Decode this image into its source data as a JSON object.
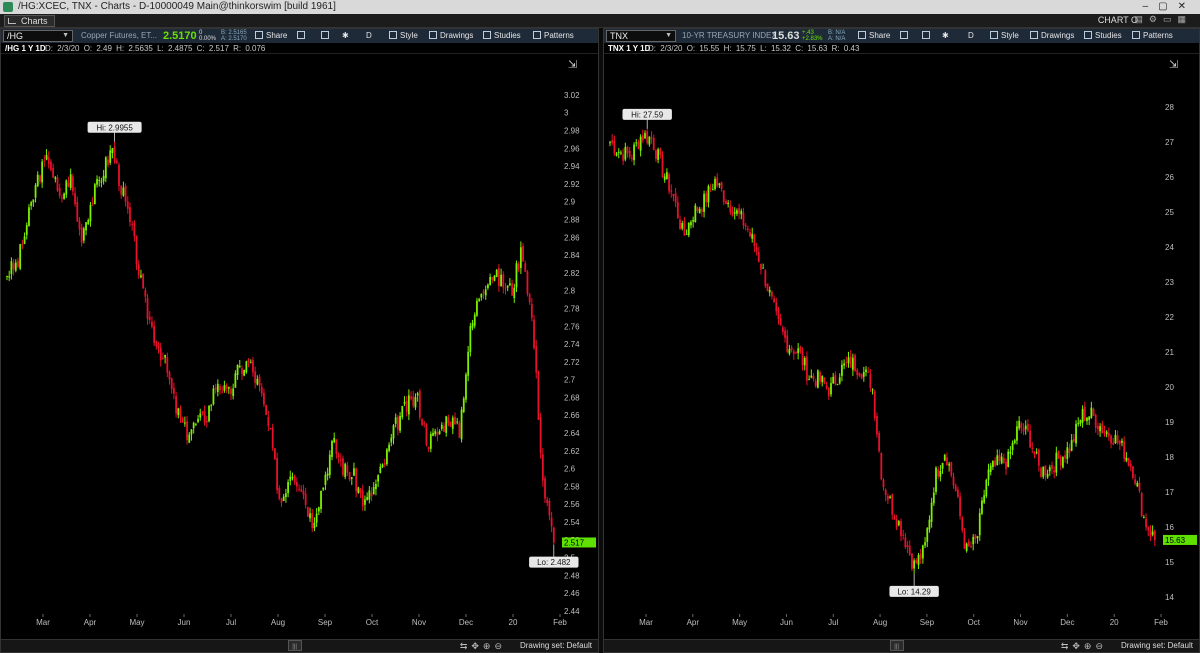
{
  "window": {
    "title": "/HG:XCEC, TNX - Charts - D-10000049 Main@thinkorswim [build 1961]"
  },
  "menubar": {
    "tab_label": "Charts",
    "chart_label": "CHART O"
  },
  "colors": {
    "up": "#7cf000",
    "down": "#e8102a",
    "toolbar": "#1e2a38",
    "price_tag": "#5fe000"
  },
  "panes": [
    {
      "symbol": "/HG",
      "description": "Copper Futures, ET...",
      "last": "2.5170",
      "change": "0",
      "change_pct": "0.00%",
      "bid": "B: 2.5165",
      "ask": "A: 2.5170",
      "toolbar": {
        "share": "Share",
        "period": "D",
        "style": "Style",
        "drawings": "Drawings",
        "studies": "Studies",
        "patterns": "Patterns"
      },
      "period_label": "/HG 1 Y 1D",
      "ohlc": "D: 2/3/20  O: 2.49  H: 2.5635  L: 2.4875  C: 2.517  R: 0.076",
      "hi_label": "Hi: 2.9955",
      "lo_label": "Lo: 2.482",
      "price_tag": "2.517",
      "drawing_set": "Drawing set: Default"
    },
    {
      "symbol": "TNX",
      "description": "10-YR TREASURY INDEX",
      "last": "15.63",
      "change": "+.43",
      "change_pct": "+2.83%",
      "bid": "B: N/A",
      "ask": "A: N/A",
      "toolbar": {
        "share": "Share",
        "period": "D",
        "style": "Style",
        "drawings": "Drawings",
        "studies": "Studies",
        "patterns": "Patterns"
      },
      "period_label": "TNX 1 Y 1D",
      "ohlc": "D: 2/3/20  O: 15.55  H: 15.75  L: 15.32  C: 15.63  R: 0.43",
      "hi_label": "Hi: 27.59",
      "lo_label": "Lo: 14.29",
      "price_tag": "15.63",
      "drawing_set": "Drawing set: Default"
    }
  ],
  "chart_data": [
    {
      "type": "candlestick",
      "title": "/HG 1 Y 1D",
      "x_labels": [
        "Mar",
        "Apr",
        "May",
        "Jun",
        "Jul",
        "Aug",
        "Sep",
        "Oct",
        "Nov",
        "Dec",
        "20",
        "Feb"
      ],
      "y_ticks": [
        "3.02",
        "3",
        "2.98",
        "2.96",
        "2.94",
        "2.92",
        "2.9",
        "2.88",
        "2.86",
        "2.84",
        "2.82",
        "2.8",
        "2.78",
        "2.76",
        "2.74",
        "2.72",
        "2.7",
        "2.68",
        "2.66",
        "2.64",
        "2.62",
        "2.6",
        "2.58",
        "2.56",
        "2.54",
        "2.52",
        "2.5",
        "2.48",
        "2.46",
        "2.44"
      ],
      "ylim": [
        2.44,
        3.03
      ],
      "series": [
        {
          "name": "close (approx.)",
          "points": [
            {
              "x": "Feb-05",
              "y": 2.82
            },
            {
              "x": "Feb-12",
              "y": 2.83
            },
            {
              "x": "Feb-19",
              "y": 2.88
            },
            {
              "x": "Feb-26",
              "y": 2.93
            },
            {
              "x": "Mar-05",
              "y": 2.95
            },
            {
              "x": "Mar-12",
              "y": 2.9
            },
            {
              "x": "Mar-19",
              "y": 2.93
            },
            {
              "x": "Mar-26",
              "y": 2.86
            },
            {
              "x": "Apr-02",
              "y": 2.9
            },
            {
              "x": "Apr-09",
              "y": 2.93
            },
            {
              "x": "Apr-16",
              "y": 2.96
            },
            {
              "x": "Apr-23",
              "y": 2.91
            },
            {
              "x": "Apr-30",
              "y": 2.86
            },
            {
              "x": "May-07",
              "y": 2.79
            },
            {
              "x": "May-14",
              "y": 2.75
            },
            {
              "x": "May-21",
              "y": 2.72
            },
            {
              "x": "May-28",
              "y": 2.67
            },
            {
              "x": "Jun-04",
              "y": 2.64
            },
            {
              "x": "Jun-11",
              "y": 2.65
            },
            {
              "x": "Jun-18",
              "y": 2.66
            },
            {
              "x": "Jun-25",
              "y": 2.7
            },
            {
              "x": "Jul-02",
              "y": 2.68
            },
            {
              "x": "Jul-09",
              "y": 2.71
            },
            {
              "x": "Jul-16",
              "y": 2.72
            },
            {
              "x": "Jul-23",
              "y": 2.69
            },
            {
              "x": "Jul-30",
              "y": 2.64
            },
            {
              "x": "Aug-06",
              "y": 2.56
            },
            {
              "x": "Aug-13",
              "y": 2.6
            },
            {
              "x": "Aug-20",
              "y": 2.58
            },
            {
              "x": "Aug-27",
              "y": 2.54
            },
            {
              "x": "Sep-03",
              "y": 2.58
            },
            {
              "x": "Sep-10",
              "y": 2.63
            },
            {
              "x": "Sep-17",
              "y": 2.6
            },
            {
              "x": "Sep-24",
              "y": 2.59
            },
            {
              "x": "Oct-01",
              "y": 2.56
            },
            {
              "x": "Oct-08",
              "y": 2.58
            },
            {
              "x": "Oct-15",
              "y": 2.61
            },
            {
              "x": "Oct-22",
              "y": 2.65
            },
            {
              "x": "Oct-29",
              "y": 2.67
            },
            {
              "x": "Nov-05",
              "y": 2.68
            },
            {
              "x": "Nov-12",
              "y": 2.63
            },
            {
              "x": "Nov-19",
              "y": 2.64
            },
            {
              "x": "Nov-26",
              "y": 2.66
            },
            {
              "x": "Dec-03",
              "y": 2.64
            },
            {
              "x": "Dec-10",
              "y": 2.75
            },
            {
              "x": "Dec-17",
              "y": 2.8
            },
            {
              "x": "Dec-24",
              "y": 2.82
            },
            {
              "x": "Dec-31",
              "y": 2.81
            },
            {
              "x": "Jan-07",
              "y": 2.8
            },
            {
              "x": "Jan-14",
              "y": 2.85
            },
            {
              "x": "Jan-21",
              "y": 2.76
            },
            {
              "x": "Jan-28",
              "y": 2.58
            },
            {
              "x": "Feb-03",
              "y": 2.517
            }
          ]
        }
      ]
    },
    {
      "type": "candlestick",
      "title": "TNX 1 Y 1D",
      "x_labels": [
        "Mar",
        "Apr",
        "May",
        "Jun",
        "Jul",
        "Aug",
        "Sep",
        "Oct",
        "Nov",
        "Dec",
        "20",
        "Feb"
      ],
      "y_ticks": [
        "28",
        "27",
        "26",
        "25",
        "24",
        "23",
        "22",
        "21",
        "20",
        "19",
        "18",
        "17",
        "16",
        "15",
        "14"
      ],
      "ylim": [
        13.6,
        28.6
      ],
      "series": [
        {
          "name": "close (approx.)",
          "points": [
            {
              "x": "Feb-05",
              "y": 27.0
            },
            {
              "x": "Feb-12",
              "y": 26.7
            },
            {
              "x": "Feb-19",
              "y": 26.6
            },
            {
              "x": "Feb-26",
              "y": 27.2
            },
            {
              "x": "Mar-05",
              "y": 27.1
            },
            {
              "x": "Mar-12",
              "y": 26.2
            },
            {
              "x": "Mar-19",
              "y": 25.5
            },
            {
              "x": "Mar-26",
              "y": 24.3
            },
            {
              "x": "Apr-02",
              "y": 25.0
            },
            {
              "x": "Apr-09",
              "y": 25.3
            },
            {
              "x": "Apr-16",
              "y": 25.9
            },
            {
              "x": "Apr-23",
              "y": 25.4
            },
            {
              "x": "Apr-30",
              "y": 25.0
            },
            {
              "x": "May-07",
              "y": 24.6
            },
            {
              "x": "May-14",
              "y": 23.9
            },
            {
              "x": "May-21",
              "y": 22.9
            },
            {
              "x": "May-28",
              "y": 21.8
            },
            {
              "x": "Jun-04",
              "y": 21.2
            },
            {
              "x": "Jun-11",
              "y": 21.0
            },
            {
              "x": "Jun-18",
              "y": 20.3
            },
            {
              "x": "Jun-25",
              "y": 20.2
            },
            {
              "x": "Jul-02",
              "y": 19.9
            },
            {
              "x": "Jul-09",
              "y": 20.5
            },
            {
              "x": "Jul-16",
              "y": 20.7
            },
            {
              "x": "Jul-23",
              "y": 20.5
            },
            {
              "x": "Jul-30",
              "y": 20.1
            },
            {
              "x": "Aug-06",
              "y": 17.3
            },
            {
              "x": "Aug-13",
              "y": 16.5
            },
            {
              "x": "Aug-20",
              "y": 15.8
            },
            {
              "x": "Aug-27",
              "y": 14.9
            },
            {
              "x": "Sep-03",
              "y": 15.3
            },
            {
              "x": "Sep-10",
              "y": 17.4
            },
            {
              "x": "Sep-17",
              "y": 18.2
            },
            {
              "x": "Sep-24",
              "y": 17.0
            },
            {
              "x": "Oct-01",
              "y": 15.3
            },
            {
              "x": "Oct-08",
              "y": 15.6
            },
            {
              "x": "Oct-15",
              "y": 17.5
            },
            {
              "x": "Oct-22",
              "y": 17.8
            },
            {
              "x": "Oct-29",
              "y": 17.9
            },
            {
              "x": "Nov-05",
              "y": 18.9
            },
            {
              "x": "Nov-12",
              "y": 18.6
            },
            {
              "x": "Nov-19",
              "y": 17.6
            },
            {
              "x": "Nov-26",
              "y": 17.7
            },
            {
              "x": "Dec-03",
              "y": 18.0
            },
            {
              "x": "Dec-10",
              "y": 18.3
            },
            {
              "x": "Dec-17",
              "y": 19.2
            },
            {
              "x": "Dec-24",
              "y": 19.2
            },
            {
              "x": "Dec-31",
              "y": 18.8
            },
            {
              "x": "Jan-07",
              "y": 18.6
            },
            {
              "x": "Jan-14",
              "y": 18.2
            },
            {
              "x": "Jan-21",
              "y": 17.6
            },
            {
              "x": "Jan-28",
              "y": 16.2
            },
            {
              "x": "Feb-03",
              "y": 15.63
            }
          ]
        }
      ]
    }
  ]
}
